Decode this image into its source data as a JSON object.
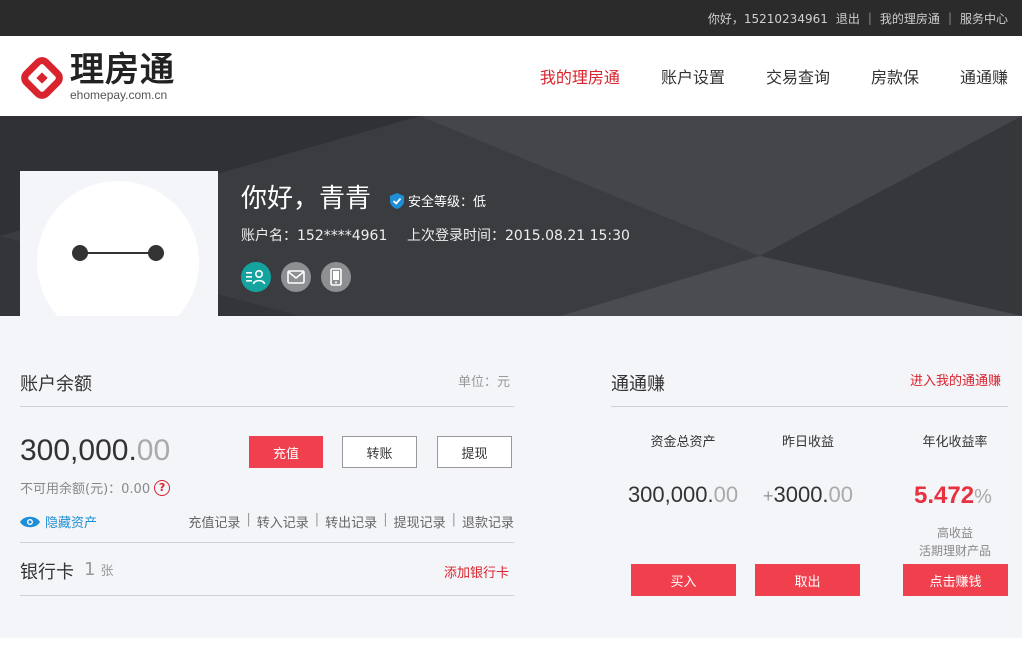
{
  "topbar": {
    "greeting": "你好，15210234961",
    "logout": "退出",
    "my_account": "我的理房通",
    "service": "服务中心"
  },
  "logo": {
    "name": "理房通",
    "domain": "ehomepay.com.cn"
  },
  "nav": {
    "items": [
      {
        "label": "我的理房通",
        "active": true
      },
      {
        "label": "账户设置",
        "active": false
      },
      {
        "label": "交易查询",
        "active": false
      },
      {
        "label": "房款保",
        "active": false
      },
      {
        "label": "通通赚",
        "active": false
      }
    ]
  },
  "profile": {
    "greeting": "你好，青青",
    "security_level": "安全等级：低",
    "account_name": "账户名：152****4961",
    "last_login": "上次登录时间：2015.08.21 15:30"
  },
  "balance": {
    "title": "账户余额",
    "unit": "单位：元",
    "amount_int": "300,000.",
    "amount_dec": "00",
    "frozen": "不可用余额(元)：0.00",
    "frozen_help": "?",
    "buttons": {
      "recharge": "充值",
      "transfer": "转账",
      "withdraw": "提现"
    },
    "hide_assets": "隐藏资产",
    "records": [
      "充值记录",
      "转入记录",
      "转出记录",
      "提现记录",
      "退款记录"
    ],
    "record_sep": "|"
  },
  "bank": {
    "title": "银行卡",
    "count": "1",
    "count_unit": "张",
    "add": "添加银行卡"
  },
  "tongtongzhuan": {
    "title": "通通赚",
    "enter_link": "进入我的通通赚",
    "total_assets_label": "资金总资产",
    "total_assets_int": "300,000.",
    "total_assets_dec": "00",
    "yesterday_label": "昨日收益",
    "yesterday_plus": "+",
    "yesterday_int": "3000.",
    "yesterday_dec": "00",
    "rate_label": "年化收益率",
    "rate_value": "5.472",
    "rate_pct": "%",
    "note_line1": "高收益",
    "note_line2": "活期理财产品",
    "buttons": {
      "buy": "买入",
      "redeem": "取出",
      "earn": "点击赚钱"
    }
  },
  "colors": {
    "brand_red": "#d9232d",
    "button_red": "#f0404e",
    "link_blue": "#1e8fd6",
    "teal": "#15a3a0"
  }
}
